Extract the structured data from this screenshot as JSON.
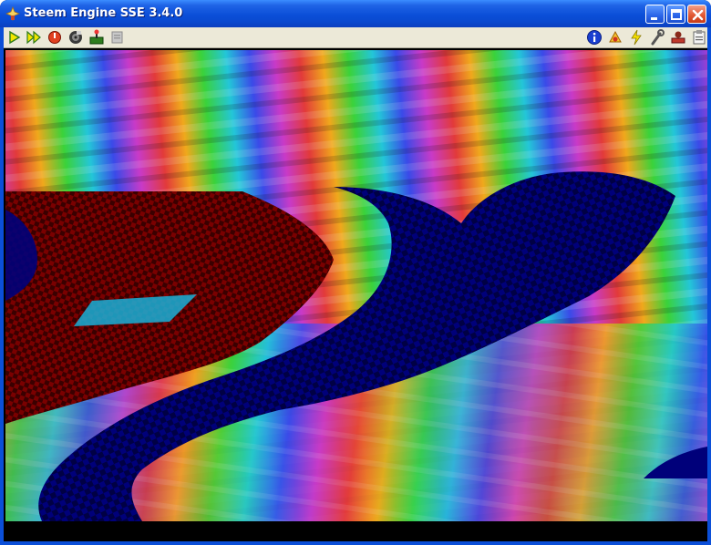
{
  "window": {
    "title": "Steem Engine SSE 3.4.0"
  },
  "title_buttons": [
    "minimize",
    "maximize",
    "close"
  ],
  "toolbar": {
    "left_icons": [
      "play-icon",
      "fast-forward-icon",
      "reset-icon",
      "disk-manager-icon",
      "joystick-icon",
      "memory-snapshot-icon"
    ],
    "right_icons": [
      "info-icon",
      "patches-icon",
      "shortcuts-icon",
      "options-icon",
      "tools-icon",
      "paste-icon"
    ]
  },
  "display": {
    "colors": {
      "dark_red": "#7a0000",
      "navy": "#00007a",
      "black": "#000000"
    }
  }
}
